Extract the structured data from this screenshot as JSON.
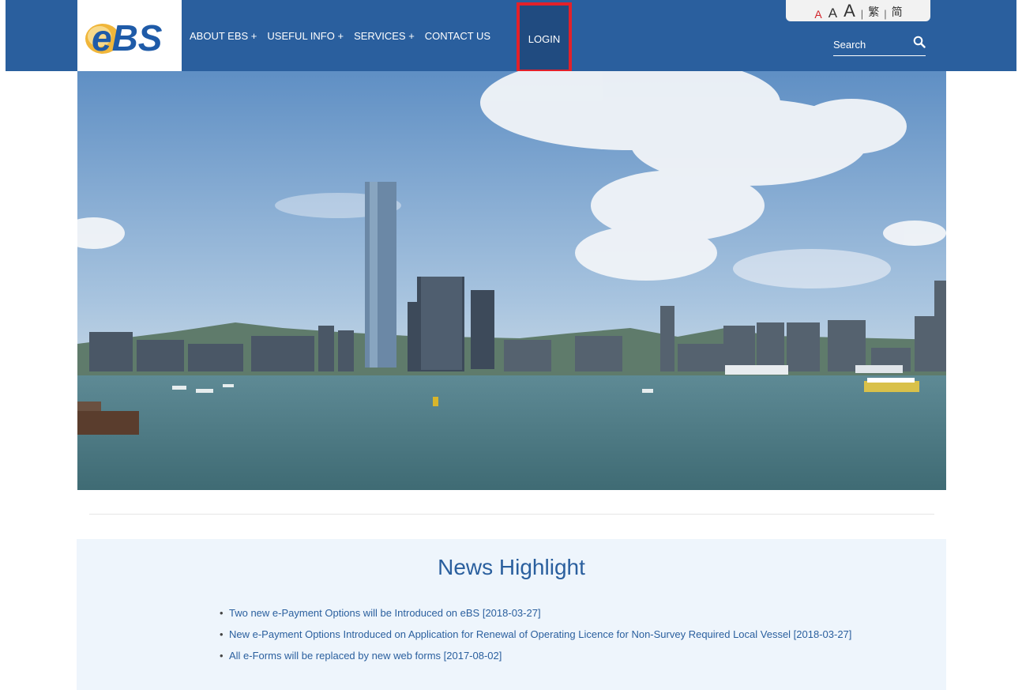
{
  "header": {
    "logo_text": "eBS",
    "nav": [
      {
        "label": "ABOUT EBS +"
      },
      {
        "label": "USEFUL INFO +"
      },
      {
        "label": "SERVICES +"
      },
      {
        "label": "CONTACT US"
      }
    ],
    "login_label": "LOGIN",
    "font_size": {
      "small": "A",
      "medium": "A",
      "large": "A"
    },
    "lang_separator": "|",
    "lang": {
      "traditional": "繁",
      "simplified": "简"
    },
    "search": {
      "placeholder": "Search"
    }
  },
  "colors": {
    "header_bg": "#2a5f9e",
    "login_highlight": "#e2212a",
    "news_bg": "#eef5fc",
    "link": "#2a5f9e"
  },
  "news": {
    "title": "News Highlight",
    "items": [
      {
        "text": "Two new e-Payment Options will be Introduced on eBS [2018-03-27]"
      },
      {
        "text": "New e-Payment Options Introduced on Application for Renewal of Operating Licence for Non-Survey Required Local Vessel [2018-03-27]"
      },
      {
        "text": "All e-Forms will be replaced by new web forms [2017-08-02]"
      }
    ]
  }
}
